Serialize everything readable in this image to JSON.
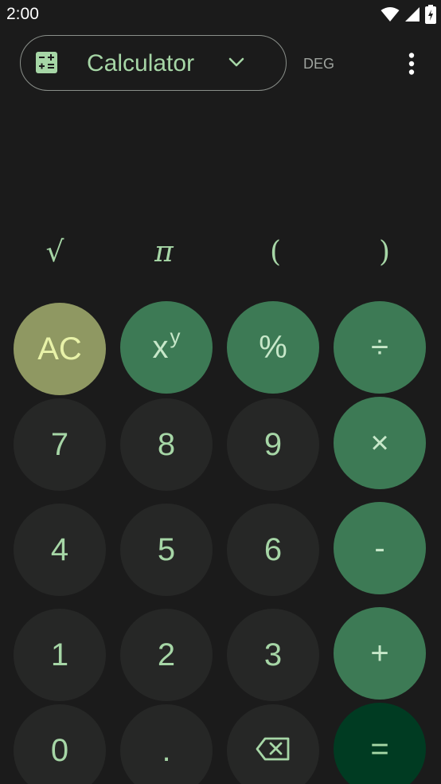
{
  "status_bar": {
    "time": "2:00",
    "icons": [
      "wifi-icon",
      "cellular-signal-icon",
      "battery-charging-icon"
    ]
  },
  "top_bar": {
    "mode_icon": "calculator-icon",
    "mode_label": "Calculator",
    "dropdown_icon": "chevron-down-icon",
    "angle_mode": "DEG",
    "overflow_icon": "more-vert-icon"
  },
  "display": {
    "expression": "",
    "result": ""
  },
  "scientific": {
    "sqrt": "√",
    "pi": "π",
    "open_paren": "(",
    "close_paren": ")"
  },
  "keypad": {
    "clear": "AC",
    "power_base": "x",
    "power_exp": "y",
    "percent": "%",
    "divide": "÷",
    "seven": "7",
    "eight": "8",
    "nine": "9",
    "multiply": "×",
    "four": "4",
    "five": "5",
    "six": "6",
    "minus": "-",
    "one": "1",
    "two": "2",
    "three": "3",
    "plus": "+",
    "zero": "0",
    "decimal": ".",
    "backspace_icon": "backspace-icon",
    "equals": "="
  },
  "colors": {
    "background": "#1b1b1b",
    "number_key": "#262726",
    "operator_key": "#3d7a55",
    "clear_key": "#8f9862",
    "equals_key": "#003b22",
    "accent_text": "#a6d6a6"
  }
}
